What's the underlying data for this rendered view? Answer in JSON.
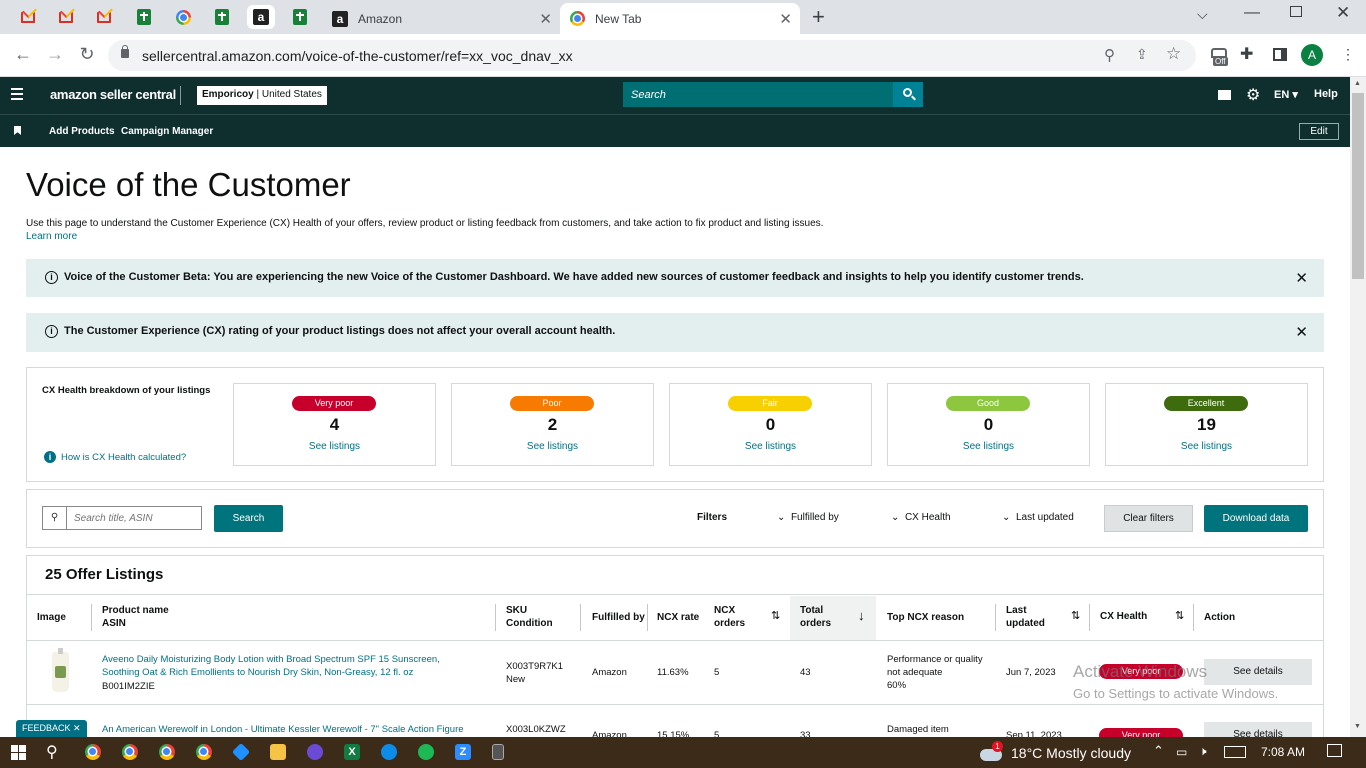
{
  "browser": {
    "tabs": [
      {
        "title": "Amazon"
      },
      {
        "title": "New Tab"
      }
    ],
    "url": "sellercentral.amazon.com/voice-of-the-customer/ref=xx_voc_dnav_xx",
    "ext_badge": "Off",
    "profile_initial": "A"
  },
  "header": {
    "logo": "amazon seller central",
    "account": {
      "name": "Emporicoy",
      "region": "United States"
    },
    "search_placeholder": "Search",
    "language": "EN",
    "help": "Help"
  },
  "subnav": {
    "items": [
      "Add Products",
      "Campaign Manager"
    ],
    "edit": "Edit"
  },
  "page": {
    "title": "Voice of the Customer",
    "description": "Use this page to understand the Customer Experience (CX) Health of your offers, review product or listing feedback from customers, and take action to fix product and listing issues.",
    "learn_more": "Learn more",
    "banner1": "Voice of the Customer Beta: You are experiencing the new Voice of the Customer Dashboard. We have added new sources of customer feedback and insights to help you identify customer trends.",
    "banner2": "The Customer Experience (CX) rating of your product listings does not affect your overall account health."
  },
  "health": {
    "heading": "CX Health breakdown of your listings",
    "how_link": "How is CX Health calculated?",
    "see_listings": "See listings",
    "cards": [
      {
        "label": "Very poor",
        "count": "4",
        "color": "#c7002b"
      },
      {
        "label": "Poor",
        "count": "2",
        "color": "#f77b00"
      },
      {
        "label": "Fair",
        "count": "0",
        "color": "#f7d000"
      },
      {
        "label": "Good",
        "count": "0",
        "color": "#8dc63f"
      },
      {
        "label": "Excellent",
        "count": "19",
        "color": "#3f6b0f"
      }
    ]
  },
  "toolbar": {
    "search_placeholder": "Search title, ASIN",
    "search_button": "Search",
    "filters_label": "Filters",
    "filter_fulfilled": "Fulfilled by",
    "filter_health": "CX Health",
    "filter_updated": "Last updated",
    "clear": "Clear filters",
    "download": "Download data"
  },
  "table": {
    "title": "25 Offer Listings",
    "headers": {
      "image": "Image",
      "product_l1": "Product name",
      "product_l2": "ASIN",
      "sku_l1": "SKU",
      "sku_l2": "Condition",
      "fulfilled": "Fulfilled by",
      "ncx_rate": "NCX rate",
      "ncx_orders_l1": "NCX",
      "ncx_orders_l2": "orders",
      "total_l1": "Total",
      "total_l2": "orders",
      "reason": "Top NCX reason",
      "updated_l1": "Last",
      "updated_l2": "updated",
      "health": "CX Health",
      "action": "Action"
    },
    "rows": [
      {
        "name_l1": "Aveeno Daily Moisturizing Body Lotion with Broad Spectrum SPF 15 Sunscreen,",
        "name_l2": "Soothing Oat & Rich Emollients to Nourish Dry Skin, Non-Greasy, 12 fl. oz",
        "asin": "B001IM2ZIE",
        "sku": "X003T9R7K1",
        "condition": "New",
        "fulfilled": "Amazon",
        "ncx_rate": "11.63%",
        "ncx_orders": "5",
        "total_orders": "43",
        "reason_l1": "Performance or quality",
        "reason_l2": "not adequate",
        "reason_pct": "60%",
        "updated": "Jun 7, 2023",
        "health": "Very poor",
        "action": "See details"
      },
      {
        "name_l1": "An American Werewolf in London - Ultimate Kessler Werewolf - 7\" Scale Action Figure",
        "sku": "X003L0KZWZ",
        "fulfilled": "Amazon",
        "ncx_rate": "15.15%",
        "ncx_orders": "5",
        "total_orders": "33",
        "reason_l1": "Damaged item",
        "updated": "Sep 11, 2023",
        "health": "Very poor",
        "action": "See details"
      }
    ]
  },
  "feedback": "FEEDBACK",
  "watermark": {
    "l1": "Activate Windows",
    "l2": "Go to Settings to activate Windows."
  },
  "taskbar": {
    "weather": "18°C  Mostly cloudy",
    "time": "7:08 AM",
    "notif": "1"
  }
}
